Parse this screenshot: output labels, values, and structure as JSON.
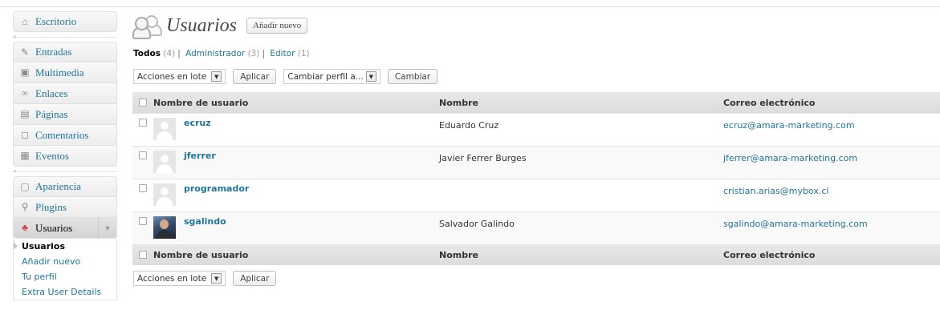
{
  "sidebar": {
    "top": [
      {
        "label": "Escritorio",
        "icon": "home-icon"
      }
    ],
    "group1": [
      {
        "label": "Entradas",
        "icon": "pin-icon"
      },
      {
        "label": "Multimedia",
        "icon": "media-icon"
      },
      {
        "label": "Enlaces",
        "icon": "link-icon"
      },
      {
        "label": "Páginas",
        "icon": "page-icon"
      },
      {
        "label": "Comentarios",
        "icon": "comment-icon"
      },
      {
        "label": "Eventos",
        "icon": "calendar-icon"
      }
    ],
    "group2": [
      {
        "label": "Apariencia",
        "icon": "appearance-icon"
      },
      {
        "label": "Plugins",
        "icon": "plug-icon"
      }
    ],
    "active": {
      "label": "Usuarios",
      "icon": "users-icon"
    },
    "submenu": [
      "Usuarios",
      "Añadir nuevo",
      "Tu perfil",
      "Extra User Details"
    ]
  },
  "header": {
    "title": "Usuarios",
    "add_new": "Añadir nuevo"
  },
  "filters": {
    "all": {
      "label": "Todos",
      "count": "(4)"
    },
    "admin": {
      "label": "Administrador",
      "count": "(3)"
    },
    "editor": {
      "label": "Editor",
      "count": "(1)"
    }
  },
  "bulk": {
    "actions": "Acciones en lote",
    "apply": "Aplicar",
    "change_role": "Cambiar perfil a...",
    "change": "Cambiar"
  },
  "table": {
    "columns": [
      "Nombre de usuario",
      "Nombre",
      "Correo electrónico"
    ],
    "rows": [
      {
        "username": "ecruz",
        "name": "Eduardo Cruz",
        "email": "ecruz@amara-marketing.com"
      },
      {
        "username": "jferrer",
        "name": "Javier Ferrer Burges",
        "email": "jferrer@amara-marketing.com"
      },
      {
        "username": "programador",
        "name": "",
        "email": "cristian.arias@mybox.cl"
      },
      {
        "username": "sgalindo",
        "name": "Salvador Galindo",
        "email": "sgalindo@amara-marketing.com"
      }
    ]
  },
  "colors": {
    "link": "#21759b",
    "header_bg": "#dfdfdf"
  }
}
